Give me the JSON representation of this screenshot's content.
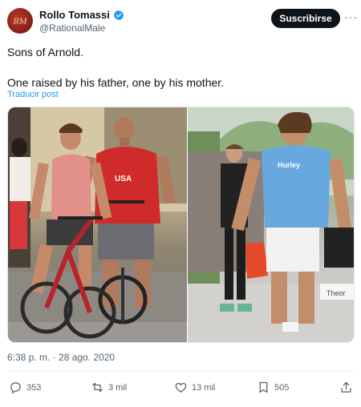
{
  "author": {
    "name": "Rollo Tomassi",
    "handle": "@RationalMale",
    "avatar_initials": "RM",
    "verified_icon": "verified-badge-icon"
  },
  "header": {
    "subscribe_label": "Suscribirse",
    "more_label": "···"
  },
  "tweet": {
    "line1": "Sons of Arnold.",
    "line2": "One raised by his father, one by his mother.",
    "translate_label": "Traducir post"
  },
  "media": {
    "left_shirt_text": "USA",
    "right_shirt_text": "Hurley",
    "right_sign_text": "Theor"
  },
  "meta": {
    "timestamp": "6:38 p. m. · 28 ago. 2020"
  },
  "actions": {
    "replies": "353",
    "reposts": "3 mil",
    "likes": "13 mil",
    "bookmarks": "505"
  },
  "colors": {
    "accent": "#1d9bf0",
    "text": "#0f1419",
    "muted": "#536471"
  }
}
